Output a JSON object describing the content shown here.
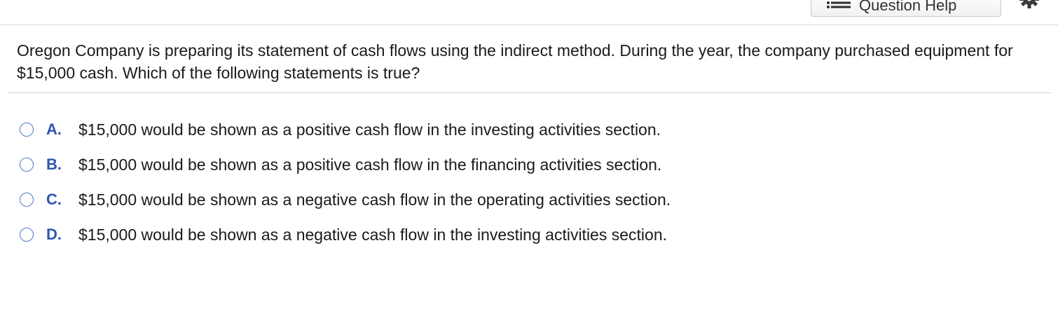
{
  "toolbar": {
    "help_label": "Question Help",
    "help_icon": "list-icon",
    "settings_icon": "gear-icon"
  },
  "question": {
    "text": "Oregon Company is preparing its statement of cash flows using the indirect method. During the year, the company purchased equipment for $15,000 cash. Which of the following statements is true?"
  },
  "options": [
    {
      "letter": "A.",
      "text": "$15,000 would be shown as a positive cash flow in the investing activities section.",
      "selected": false
    },
    {
      "letter": "B.",
      "text": "$15,000 would be shown as a positive cash flow in the financing activities section.",
      "selected": false
    },
    {
      "letter": "C.",
      "text": "$15,000 would be shown as a negative cash flow in the operating activities section.",
      "selected": false
    },
    {
      "letter": "D.",
      "text": "$15,000 would be shown as a negative cash flow in the investing activities section.",
      "selected": false
    }
  ],
  "colors": {
    "accent": "#2f56b0",
    "radio_border": "#4d78c8",
    "rule": "#cfcfcf"
  }
}
